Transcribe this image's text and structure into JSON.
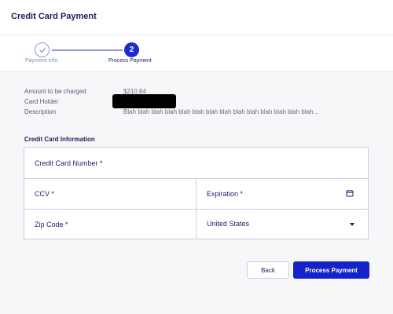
{
  "header": {
    "title": "Credit Card Payment"
  },
  "stepper": {
    "steps": [
      {
        "label": "Payment Info",
        "state": "complete"
      },
      {
        "label": "Process Payment",
        "number": "2",
        "state": "active"
      }
    ]
  },
  "summary": {
    "amount_label": "Amount to be charged",
    "amount_value": "$210.84",
    "holder_label": "Card Holder",
    "description_label": "Description",
    "description_value": "Blah blah blah blah blah blah blah blah blah blah blah blah blah blah…"
  },
  "form": {
    "section_title": "Credit Card Information",
    "card_number_label": "Credit Card Number *",
    "ccv_label": "CCV *",
    "expiration_label": "Expiration *",
    "zip_label": "Zip Code *",
    "country_value": "United States"
  },
  "actions": {
    "back_label": "Back",
    "pay_label": "Process Payment"
  },
  "colors": {
    "accent": "#1323c9",
    "step_inactive": "#8e98d2",
    "text_primary": "#1b1f6e"
  },
  "icons": {
    "step1": "check-icon",
    "expiration": "calendar-icon",
    "country": "caret-down-icon"
  }
}
